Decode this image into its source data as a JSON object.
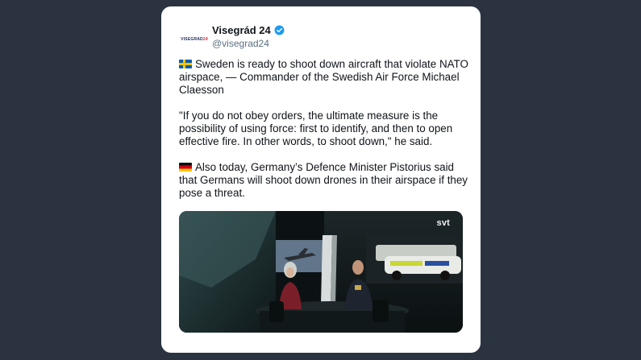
{
  "tweet": {
    "avatar_text": "VISEGRAD",
    "avatar_text_accent": "24",
    "display_name": "Visegrád 24",
    "handle": "@visegrad24",
    "paragraphs": [
      {
        "flag": "sweden-flag-icon",
        "text": "Sweden is ready to shoot down aircraft that violate NATO airspace, — Commander of the Swedish Air Force Michael Claesson"
      },
      {
        "flag": null,
        "text": "\"If you do not obey orders, the ultimate measure is the possibility of using force: first to identify, and then to open effective fire. In other words, to shoot down,\" he said."
      },
      {
        "flag": "germany-flag-icon",
        "text": "Also today, Germany’s Defence Minister Pistorius said that Germans will shoot down drones in their airspace if they pose a threat."
      }
    ],
    "media": {
      "watermark": "svt"
    }
  },
  "colors": {
    "background": "#2b3340",
    "card": "#ffffff",
    "verified": "#1d9bf0",
    "text": "#0f1419",
    "secondary": "#5b7083"
  }
}
